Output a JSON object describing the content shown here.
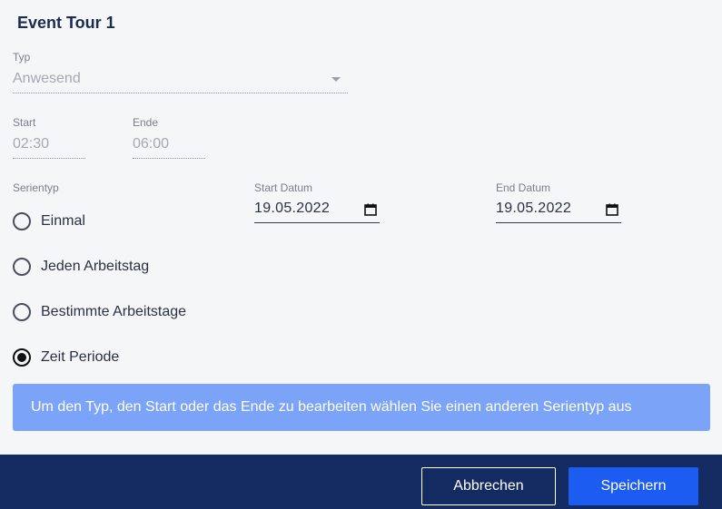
{
  "dialog": {
    "title": "Event Tour 1"
  },
  "type_field": {
    "label": "Typ",
    "value": "Anwesend"
  },
  "time": {
    "start_label": "Start",
    "start_value": "02:30",
    "end_label": "Ende",
    "end_value": "06:00"
  },
  "series": {
    "label": "Serientyp",
    "options": [
      {
        "label": "Einmal",
        "checked": false
      },
      {
        "label": "Jeden Arbeitstag",
        "checked": false
      },
      {
        "label": "Bestimmte Arbeitstage",
        "checked": false
      },
      {
        "label": "Zeit Periode",
        "checked": true
      }
    ]
  },
  "dates": {
    "start_label": "Start Datum",
    "start_value": "19.05.2022",
    "end_label": "End Datum",
    "end_value": "19.05.2022"
  },
  "info": {
    "message": "Um den Typ, den Start oder das Ende zu bearbeiten wählen Sie einen anderen Serientyp aus"
  },
  "footer": {
    "cancel_label": "Abbrechen",
    "save_label": "Speichern"
  },
  "colors": {
    "footer_bg": "#142b62",
    "save_button": "#1d5cf0",
    "info_bg": "#7ba3f7",
    "title": "#1b2a4e"
  }
}
